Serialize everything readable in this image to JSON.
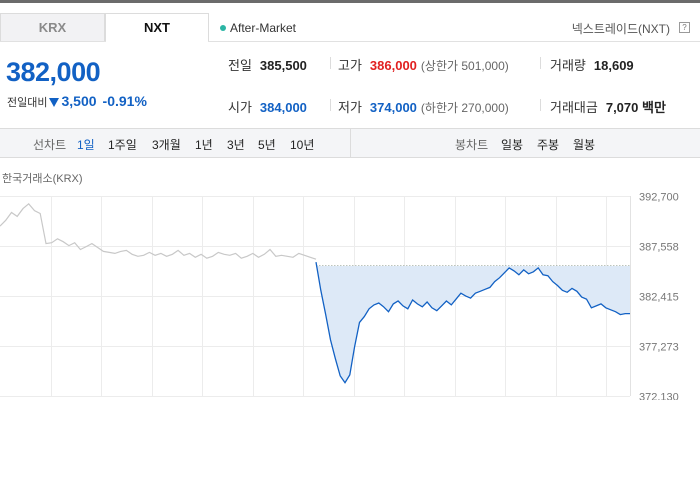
{
  "tabs": [
    {
      "label": "KRX"
    },
    {
      "label": "NXT"
    }
  ],
  "session": "After-Market",
  "exchange_label": "넥스트레이드(NXT)",
  "help_icon_label": "?",
  "current_price": "382,000",
  "change": {
    "label": "전일대비",
    "amount": "3,500",
    "percent": "-0.91%"
  },
  "stats": {
    "prev_close": {
      "label": "전일",
      "value": "385,500"
    },
    "high": {
      "label": "고가",
      "value": "386,000",
      "limit": "(상한가 501,000)"
    },
    "volume": {
      "label": "거래량",
      "value": "18,609"
    },
    "open": {
      "label": "시가",
      "value": "384,000"
    },
    "low": {
      "label": "저가",
      "value": "374,000",
      "limit": "(하한가 270,000)"
    },
    "trade_value": {
      "label": "거래대금",
      "value": "7,070 백만"
    }
  },
  "toolbar": {
    "line_label": "선차트",
    "periods": [
      "1일",
      "1주일",
      "3개월",
      "1년",
      "3년",
      "5년",
      "10년"
    ],
    "candle_label": "봉차트",
    "candles": [
      "일봉",
      "주봉",
      "월봉"
    ]
  },
  "chart_title": "한국거래소(KRX)",
  "colors": {
    "accent_blue": "#1261c4",
    "up_red": "#e12020",
    "line_gray": "#c8c8c8",
    "area_fill": "#dde9f7"
  },
  "chart_data": {
    "type": "line",
    "title": "",
    "xlabel": "",
    "ylabel": "",
    "ylim": [
      372130,
      392700
    ],
    "y_ticks": [
      "392,700",
      "387,558",
      "382,415",
      "377,273",
      "372,130"
    ],
    "y_tick_values": [
      392700,
      387558,
      382415,
      377273,
      372130
    ],
    "reference_value": 385500,
    "grid": true,
    "series": [
      {
        "style": "gray",
        "values": [
          389600,
          390200,
          391000,
          390600,
          391400,
          391900,
          391200,
          390900,
          387800,
          387900,
          388300,
          388000,
          387600,
          387900,
          387200,
          387500,
          387800,
          387400,
          387000,
          386900,
          386800,
          387000,
          387100,
          386700,
          386500,
          386600,
          386900,
          386600,
          386800,
          386500,
          386700,
          387100,
          386600,
          386800,
          386400,
          386700,
          386300,
          386500,
          386900,
          386700,
          386600,
          386800,
          386300,
          386500,
          386800,
          386400,
          386700,
          387200,
          386500,
          386600,
          386500,
          386400,
          386800,
          386600,
          386400,
          386200
        ]
      },
      {
        "style": "blue",
        "values": [
          385900,
          383000,
          380500,
          377900,
          376000,
          374200,
          373500,
          374300,
          377200,
          379700,
          380300,
          381100,
          381500,
          381700,
          381300,
          380800,
          381600,
          381900,
          381400,
          381100,
          382000,
          381600,
          381300,
          381800,
          381200,
          380900,
          381400,
          381900,
          381500,
          382100,
          382700,
          382400,
          382200,
          382700,
          382900,
          383100,
          383300,
          383900,
          384300,
          384800,
          385300,
          385000,
          384600,
          385100,
          384700,
          384900,
          385300,
          384600,
          384500,
          383900,
          383500,
          383000,
          382800,
          383200,
          382900,
          382300,
          382100,
          381200,
          381400,
          381600,
          381200,
          381000,
          380800,
          380500,
          380600,
          380600
        ]
      }
    ]
  }
}
